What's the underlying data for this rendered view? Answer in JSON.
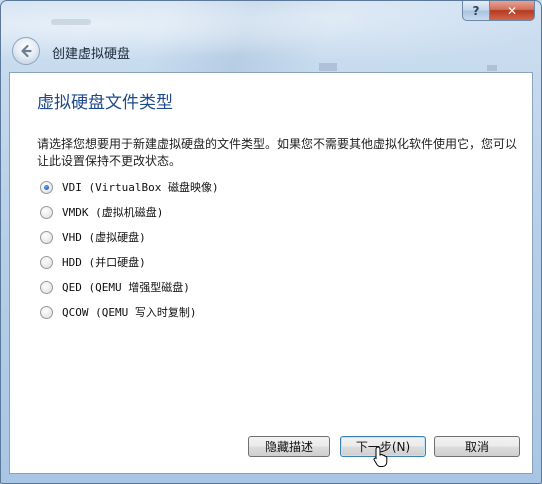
{
  "window": {
    "title": "创建虚拟硬盘",
    "caption": {
      "help": "?",
      "close": "✕"
    }
  },
  "page": {
    "heading": "虚拟硬盘文件类型",
    "description": "请选择您想要用于新建虚拟硬盘的文件类型。如果您不需要其他虚拟化软件使用它，您可以让此设置保持不更改状态。"
  },
  "options": [
    {
      "label": "VDI (VirtualBox 磁盘映像)",
      "checked": true
    },
    {
      "label": "VMDK (虚拟机磁盘)",
      "checked": false
    },
    {
      "label": "VHD (虚拟硬盘)",
      "checked": false
    },
    {
      "label": "HDD (并口硬盘)",
      "checked": false
    },
    {
      "label": "QED (QEMU 增强型磁盘)",
      "checked": false
    },
    {
      "label": "QCOW (QEMU 写入时复制)",
      "checked": false
    }
  ],
  "buttons": {
    "hide_description": "隐藏描述",
    "next": "下一步(N)",
    "cancel": "取消"
  },
  "colors": {
    "heading": "#1f4a8b",
    "close_button": "#c7472d",
    "default_button_border": "#3c7fb1"
  }
}
